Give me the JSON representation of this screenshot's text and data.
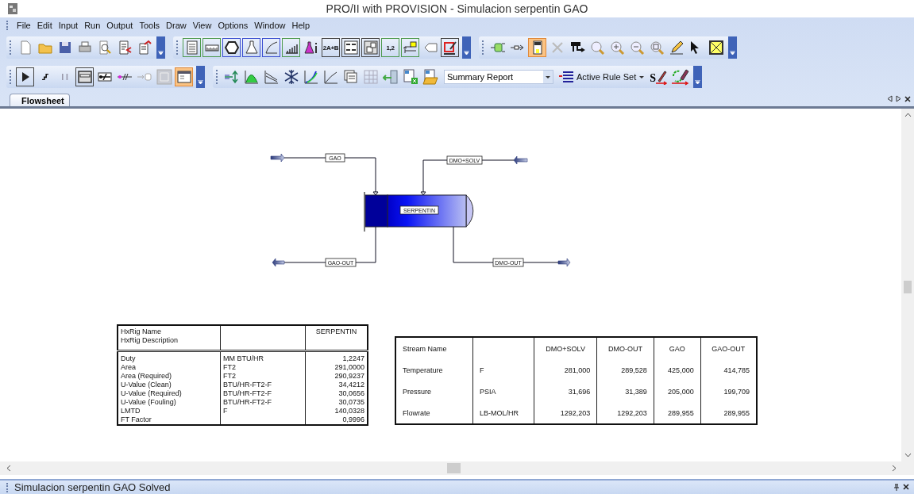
{
  "window": {
    "title": "PRO/II with PROVISION - Simulacion serpentin GAO"
  },
  "menu": [
    "File",
    "Edit",
    "Input",
    "Run",
    "Output",
    "Tools",
    "Draw",
    "View",
    "Options",
    "Window",
    "Help"
  ],
  "toolbars": [
    {
      "buttons": [
        {
          "pressed": false
        },
        {
          "pressed": false
        },
        {
          "pressed": false
        },
        {
          "pressed": false
        },
        {
          "pressed": false
        },
        {
          "pressed": false
        },
        {
          "pressed": false
        }
      ]
    },
    {
      "buttons": [
        {
          "pressed": false
        },
        {
          "pressed": false
        },
        {
          "pressed": false
        },
        {
          "pressed": false
        },
        {
          "pressed": false
        },
        {
          "pressed": false
        },
        {
          "pressed": false
        },
        {
          "pressed": false,
          "label": "2A+B"
        },
        {
          "pressed": false
        },
        {
          "pressed": false
        },
        {
          "pressed": false,
          "label": "1,2"
        },
        {
          "pressed": false
        },
        {
          "pressed": false
        },
        {
          "pressed": false
        }
      ]
    },
    {
      "buttons": [
        {
          "pressed": false
        },
        {
          "pressed": false
        },
        {
          "pressed": true
        },
        {
          "pressed": false
        },
        {
          "pressed": false
        },
        {
          "pressed": false
        },
        {
          "pressed": false
        },
        {
          "pressed": false
        },
        {
          "pressed": false
        },
        {
          "pressed": false
        },
        {
          "pressed": false
        },
        {
          "pressed": false
        }
      ]
    },
    {
      "buttons": [
        {
          "pressed": false
        },
        {
          "pressed": false
        },
        {
          "pressed": false
        },
        {
          "pressed": false
        },
        {
          "pressed": false
        },
        {
          "pressed": false
        },
        {
          "pressed": false
        },
        {
          "pressed": false
        },
        {
          "pressed": true
        }
      ]
    },
    {
      "buttons": [
        {
          "pressed": false
        },
        {
          "pressed": false
        },
        {
          "pressed": false
        },
        {
          "pressed": false
        },
        {
          "pressed": false
        },
        {
          "pressed": false
        },
        {
          "pressed": false
        },
        {
          "pressed": false
        },
        {
          "pressed": false
        },
        {
          "pressed": false
        },
        {
          "pressed": false
        }
      ]
    }
  ],
  "report_dropdown": {
    "value": "Summary Report"
  },
  "rule_set_button": {
    "label": "Active Rule Set"
  },
  "spec_button": {
    "label": "S"
  },
  "tabs": [
    {
      "label": "Flowsheet",
      "selected": true
    }
  ],
  "flowsheet": {
    "streams": [
      {
        "label": "GAO"
      },
      {
        "label": "DMO+SOLV"
      },
      {
        "label": "GAO-OUT"
      },
      {
        "label": "DMO-OUT"
      }
    ],
    "unit": {
      "label": "SERPENTIN"
    }
  },
  "hx_table": {
    "header": [
      "HxRig Name",
      "HxRig Description"
    ],
    "column": "SERPENTIN",
    "rows": [
      {
        "name": "Duty",
        "unit": "MM BTU/HR",
        "value": "1,2247"
      },
      {
        "name": "Area",
        "unit": "FT2",
        "value": "291,0000"
      },
      {
        "name": "Area (Required)",
        "unit": "FT2",
        "value": "290,9237"
      },
      {
        "name": "U-Value (Clean)",
        "unit": "BTU/HR-FT2-F",
        "value": "34,4212"
      },
      {
        "name": "U-Value (Required)",
        "unit": "BTU/HR-FT2-F",
        "value": "30,0656"
      },
      {
        "name": "U-Value (Fouling)",
        "unit": "BTU/HR-FT2-F",
        "value": "30,0735"
      },
      {
        "name": "LMTD",
        "unit": "F",
        "value": "140,0328"
      },
      {
        "name": "FT Factor",
        "value": "0,9996"
      }
    ]
  },
  "stream_table": {
    "header": "Stream Name",
    "columns": [
      "DMO+SOLV",
      "DMO-OUT",
      "GAO",
      "GAO-OUT"
    ],
    "rows": [
      {
        "name": "Temperature",
        "unit": "F",
        "values": [
          "281,000",
          "289,528",
          "425,000",
          "414,785"
        ]
      },
      {
        "name": "Pressure",
        "unit": "PSIA",
        "values": [
          "31,696",
          "31,389",
          "205,000",
          "199,709"
        ]
      },
      {
        "name": "Flowrate",
        "unit": "LB-MOL/HR",
        "values": [
          "1292,203",
          "1292,203",
          "289,955",
          "289,955"
        ]
      }
    ]
  },
  "status_bar": {
    "text": "Simulacion serpentin GAO Solved"
  }
}
